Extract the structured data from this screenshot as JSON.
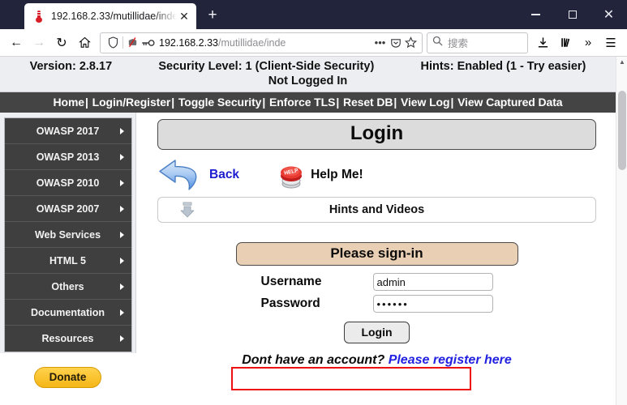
{
  "browser": {
    "tab": {
      "title": "192.168.2.33/mutillidae/inde",
      "favicon": "thermometer-icon",
      "close_label": "✕",
      "new_tab_label": "+"
    },
    "window_controls": {
      "minimize": "minimize-icon",
      "maximize": "maximize-icon",
      "close": "✕"
    },
    "nav": {
      "back": "←",
      "forward": "→",
      "reload": "↻",
      "home": "⌂"
    },
    "url": {
      "host": "192.168.2.33",
      "path": "/mutillidae/inde",
      "shield_icon": "shield-icon",
      "broken_protection_icon": "broken-shield-icon",
      "key_icon": "key-icon",
      "page_actions": "•••",
      "pocket_icon": "pocket-icon",
      "bookmark_icon": "star-icon"
    },
    "search": {
      "placeholder": "搜索",
      "icon": "search-icon"
    },
    "toolbar_right": {
      "downloads": "downloads-icon",
      "library": "library-icon",
      "overflow": "»",
      "menu": "☰"
    }
  },
  "header": {
    "version": "Version: 2.8.17",
    "security_level": "Security Level: 1 (Client-Side Security)",
    "hints": "Hints: Enabled (1 - Try easier)",
    "login_status": "Not Logged In",
    "nav_links": [
      "Home",
      "Login/Register",
      "Toggle Security",
      "Enforce TLS",
      "Reset DB",
      "View Log",
      "View Captured Data"
    ],
    "nav_separator": "|"
  },
  "sidebar": {
    "items": [
      {
        "label": "OWASP 2017"
      },
      {
        "label": "OWASP 2013"
      },
      {
        "label": "OWASP 2010"
      },
      {
        "label": "OWASP 2007"
      },
      {
        "label": "Web Services"
      },
      {
        "label": "HTML 5"
      },
      {
        "label": "Others"
      },
      {
        "label": "Documentation"
      },
      {
        "label": "Resources"
      }
    ],
    "donate_label": "Donate"
  },
  "main": {
    "page_title": "Login",
    "back_label": "Back",
    "help_label": "Help Me!",
    "hints_label": "Hints and Videos",
    "form": {
      "legend": "Please sign-in",
      "username_label": "Username",
      "username_value": "admin",
      "password_label": "Password",
      "password_value": "••••••",
      "submit_label": "Login"
    },
    "register_prompt": "Dont have an account? ",
    "register_link": "Please register here"
  },
  "colors": {
    "chrome_tabstrip": "#22243c",
    "header_bg": "#eceef2",
    "nav_bar_bg": "#444444",
    "menu_bg": "#3f3f3f",
    "donate_yellow": "#f5b616",
    "signin_tan": "#e9cfb4",
    "highlight_red": "#ee1111",
    "link_blue": "#2222e0"
  }
}
